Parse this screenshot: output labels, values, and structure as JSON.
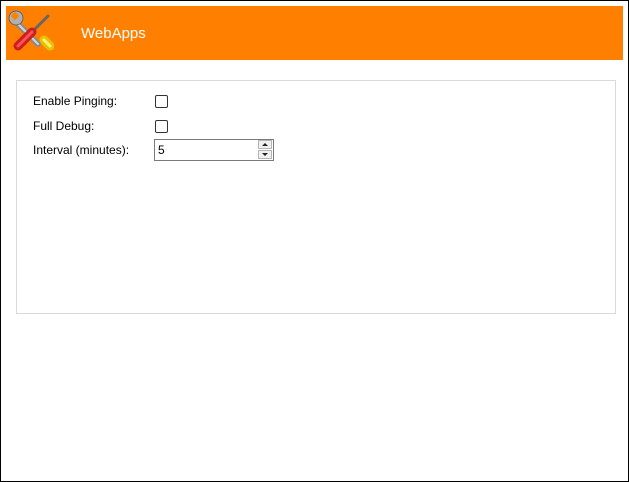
{
  "header": {
    "title": "WebApps",
    "logo_icon": "tools-icon",
    "background_color": "#ff8000"
  },
  "settings": {
    "enable_pinging_label": "Enable Pinging:",
    "enable_pinging_checked": false,
    "full_debug_label": "Full Debug:",
    "full_debug_checked": false,
    "interval_label": "Interval (minutes):",
    "interval_value": "5"
  }
}
